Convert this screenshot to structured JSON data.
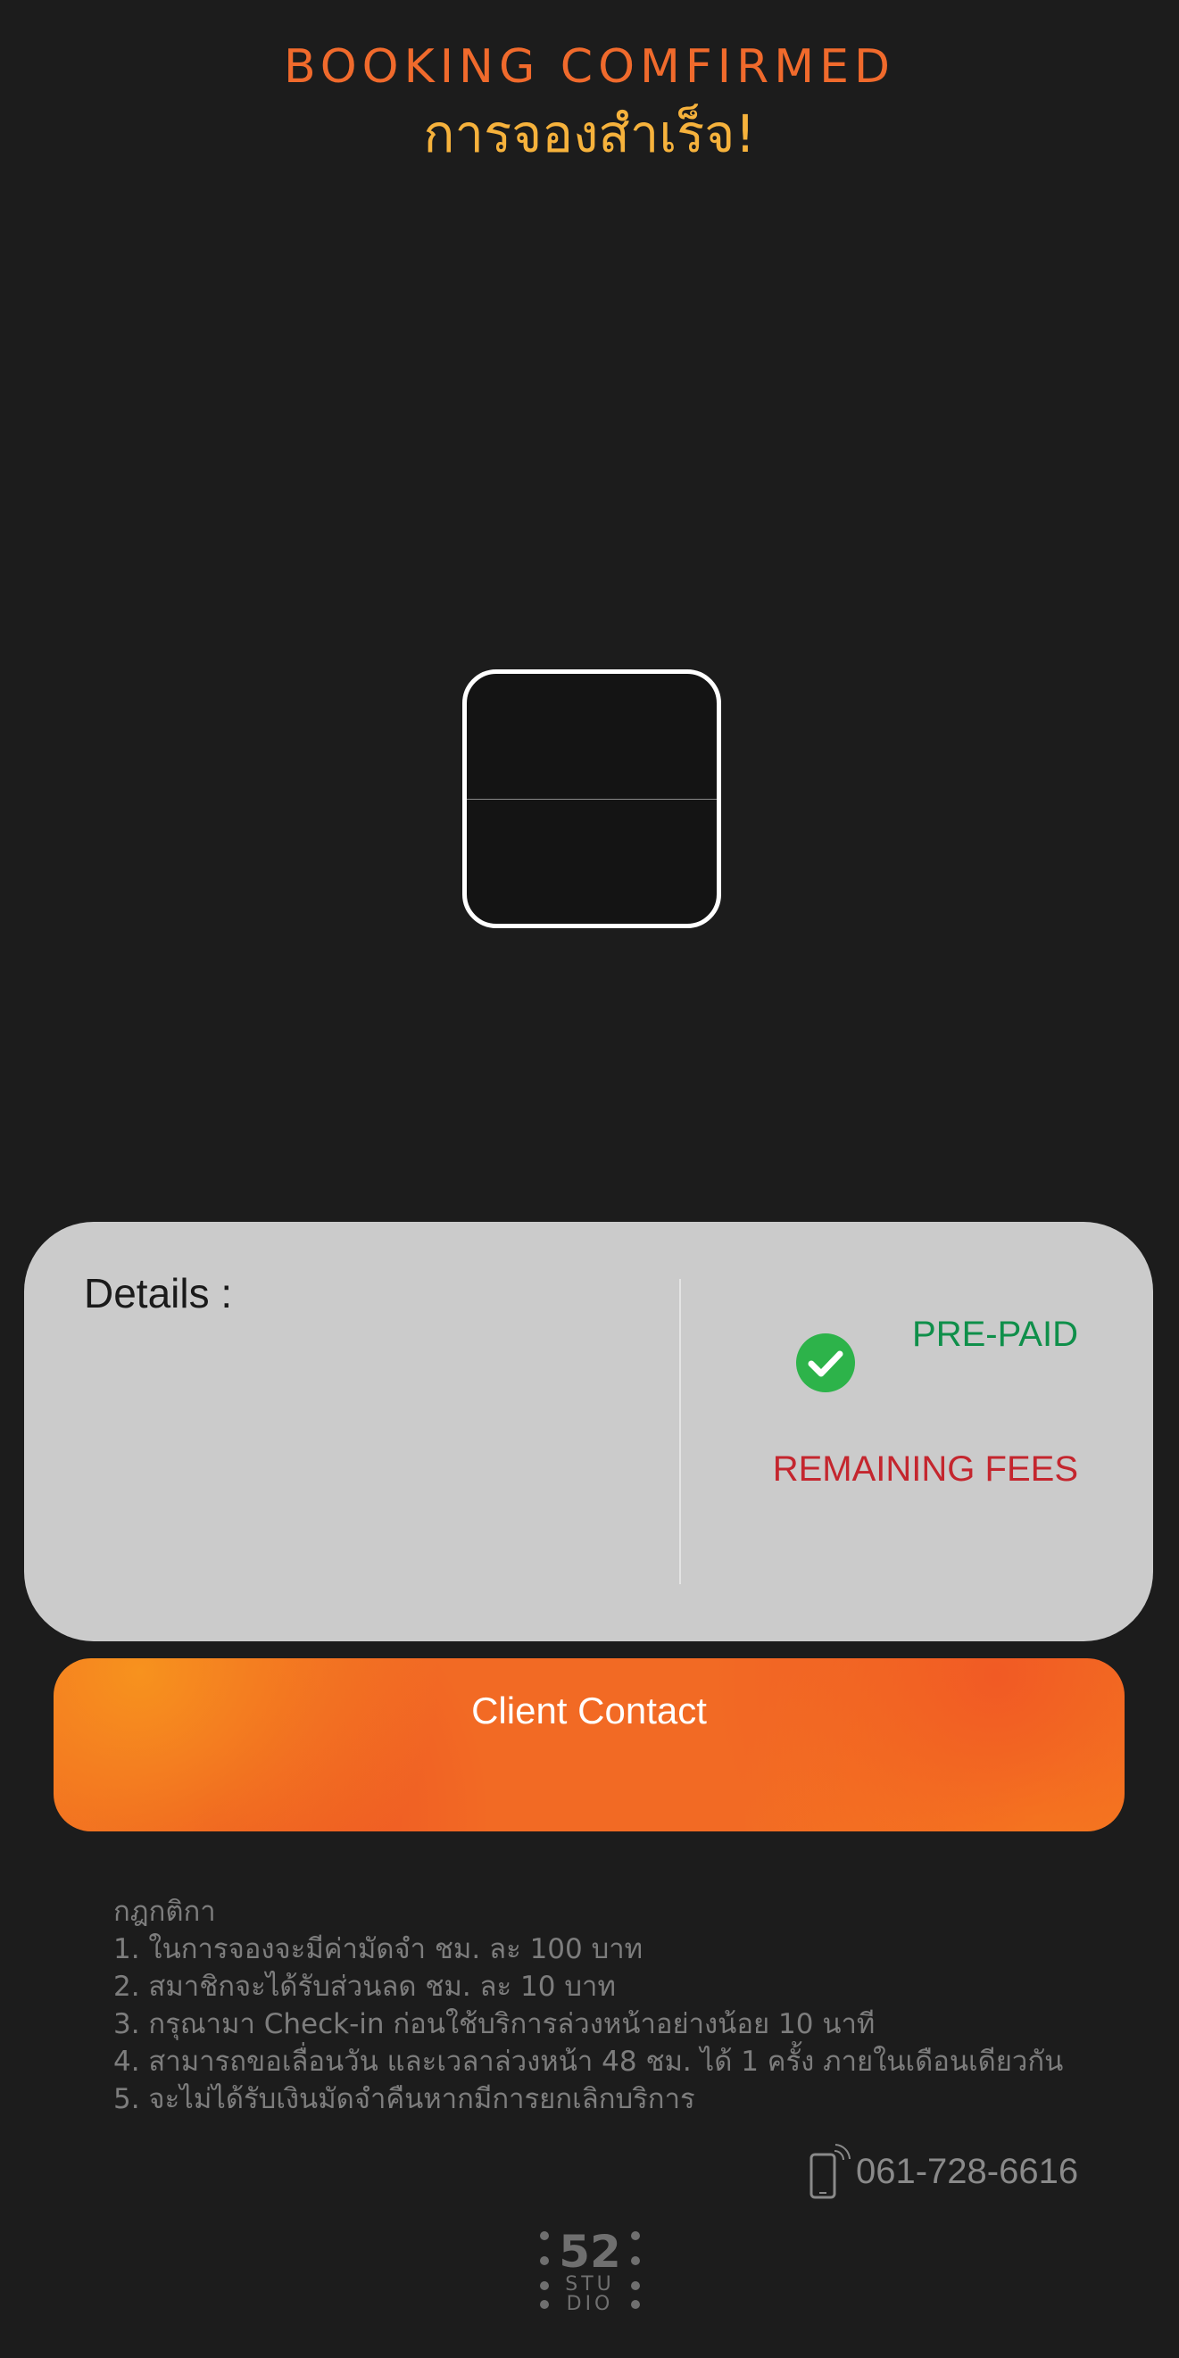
{
  "header": {
    "title_en": "BOOKING COMFIRMED",
    "title_th": "การจองสำเร็จ!"
  },
  "qr": {
    "icon": "qr-frame-icon"
  },
  "details": {
    "title": "Details :",
    "prepaid_label": "PRE-PAID",
    "remaining_label": "REMAINING FEES",
    "check_icon": "check-circle-icon",
    "colors": {
      "card": "#cbcbcb",
      "prepaid": "#0f8f4a",
      "remaining": "#c4262e",
      "check": "#2db34a"
    }
  },
  "contact_button": {
    "label": "Client Contact",
    "colors": [
      "#f7921e",
      "#f26a24",
      "#ec4d23"
    ]
  },
  "rules": {
    "heading": "กฎกติกา",
    "items": [
      "1. ในการจองจะมีค่ามัดจำ ชม. ละ 100 บาท",
      "2. สมาชิกจะได้รับส่วนลด ชม. ละ 10 บาท",
      "3. กรุณามา Check-in ก่อนใช้บริการล่วงหน้าอย่างน้อย 10 นาที",
      "4. สามารถขอเลื่อนวัน และเวลาล่วงหน้า 48 ชม. ได้ 1 ครั้ง ภายในเดือนเดียวกัน",
      "5. จะไม่ได้รับเงินมัดจำคืนหากมีการยกเลิกบริการ"
    ]
  },
  "contact": {
    "phone": "061-728-6616",
    "icon": "phone-icon"
  },
  "logo": {
    "number": "52",
    "line1": "STU",
    "line2": "DIO"
  },
  "theme": {
    "background": "#1c1c1c",
    "title_en_color": "#f06a2c",
    "title_th_color": "#f6b23c"
  }
}
